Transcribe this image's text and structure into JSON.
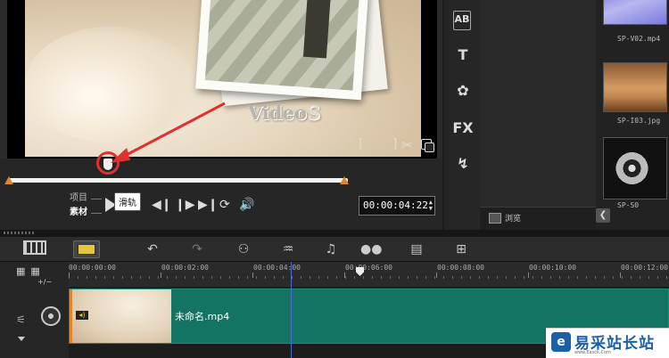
{
  "preview": {
    "video_text_main": "Video",
    "video_text_tail": "S",
    "tooltip": "滑轨",
    "mode_project": "项目",
    "mode_clip": "素材",
    "timecode": "00:00:04:22"
  },
  "library": {
    "items": [
      {
        "label": "SP-V02.mp4"
      },
      {
        "label": "SP-I03.jpg"
      },
      {
        "label": "SP-S0"
      }
    ],
    "browse_label": "浏览"
  },
  "tools": {
    "ab_label": "AB",
    "title_label": "T",
    "fx_label": "FX"
  },
  "ruler": {
    "zoom_label": "+/−",
    "ticks": [
      "00:00:00:00",
      "00:00:02:00",
      "00:00:04:00",
      "00:00:06:00",
      "00:00:08:00",
      "00:00:10:00",
      "00:00:12:00"
    ]
  },
  "track": {
    "clip_name": "未命名.mp4"
  },
  "logo": {
    "text": "易采站长站",
    "sub": "www.Easck.Com"
  },
  "colors": {
    "accent_orange": "#e0872a",
    "clip_teal": "#147463",
    "highlight_red": "#e03030",
    "playhead_blue": "#4c6dd6"
  }
}
